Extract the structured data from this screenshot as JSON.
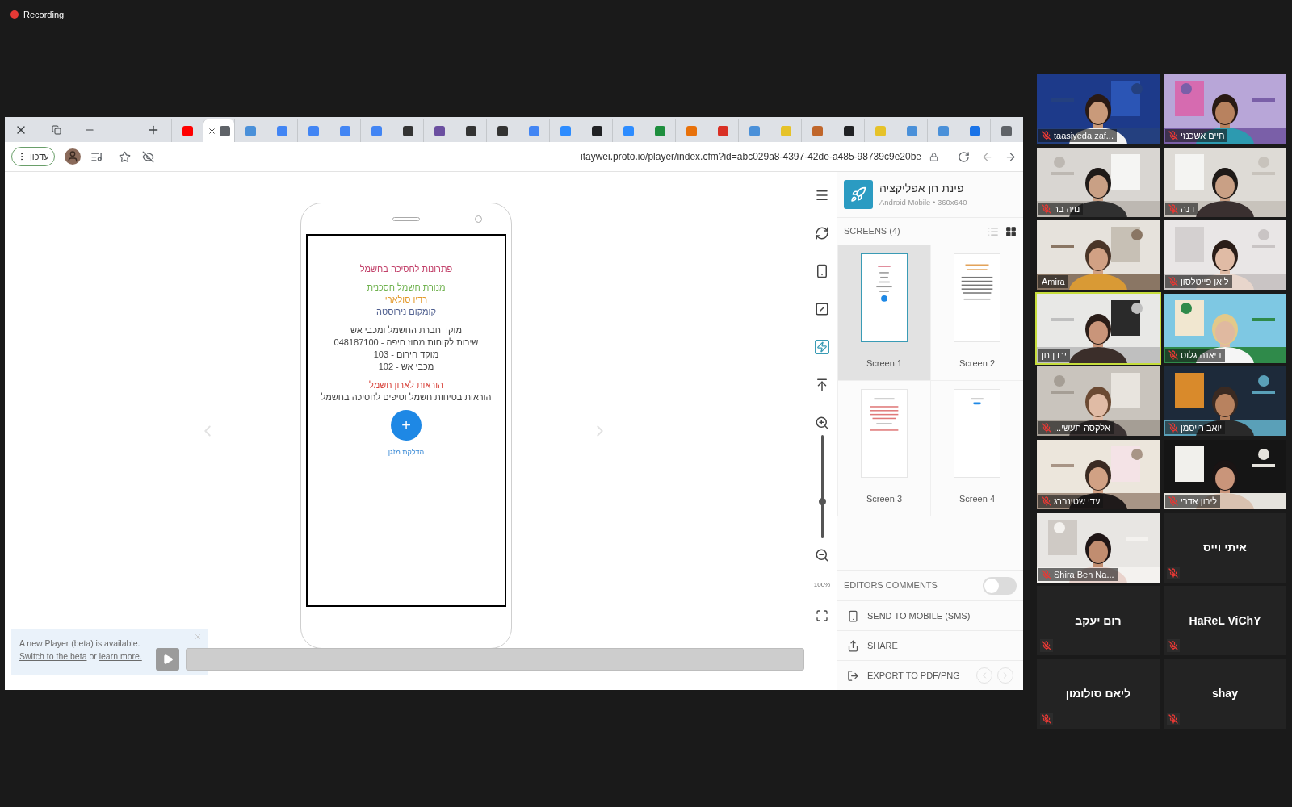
{
  "recording": {
    "label": "Recording"
  },
  "browser": {
    "tabs": [
      {
        "color": "#ff0000",
        "selected": false
      },
      {
        "color": "#5f6368",
        "selected": true
      },
      {
        "color": "#4a90d9",
        "selected": false
      },
      {
        "color": "#4285f4",
        "selected": false
      },
      {
        "color": "#4285f4",
        "selected": false
      },
      {
        "color": "#4285f4",
        "selected": false
      },
      {
        "color": "#4285f4",
        "selected": false
      },
      {
        "color": "#333333",
        "selected": false
      },
      {
        "color": "#6b4fa0",
        "selected": false
      },
      {
        "color": "#333333",
        "selected": false
      },
      {
        "color": "#333333",
        "selected": false
      },
      {
        "color": "#4285f4",
        "selected": false
      },
      {
        "color": "#2d8cff",
        "selected": false
      },
      {
        "color": "#202124",
        "selected": false
      },
      {
        "color": "#2d8cff",
        "selected": false
      },
      {
        "color": "#1e8e3e",
        "selected": false
      },
      {
        "color": "#e8710a",
        "selected": false
      },
      {
        "color": "#d93025",
        "selected": false
      },
      {
        "color": "#4a90d9",
        "selected": false
      },
      {
        "color": "#e6c229",
        "selected": false
      },
      {
        "color": "#c0662b",
        "selected": false
      },
      {
        "color": "#202124",
        "selected": false
      },
      {
        "color": "#e6c229",
        "selected": false
      },
      {
        "color": "#4a90d9",
        "selected": false
      },
      {
        "color": "#4a90d9",
        "selected": false
      },
      {
        "color": "#1a73e8",
        "selected": false
      },
      {
        "color": "#5f6368",
        "selected": false
      }
    ],
    "profile_button": "עדכון",
    "url": "itaywei.proto.io/player/index.cfm?id=abc029a8-4397-42de-a485-98739c9e20be"
  },
  "phone_screen": {
    "groups": [
      {
        "lines": [
          {
            "text": "פתרונות לחסיכה בחשמל",
            "color": "#c2416a"
          }
        ]
      },
      {
        "lines": [
          {
            "text": "מנורת חשמל חסכנית",
            "color": "#6fb24e"
          },
          {
            "text": "רדיו סולארי",
            "color": "#e39a2d"
          },
          {
            "text": "קומקום נירוסטה",
            "color": "#4f5f8f"
          }
        ]
      },
      {
        "lines": [
          {
            "text": "מוקד חברת החשמל ומכבי אש",
            "color": "#444444"
          },
          {
            "text": "שירות לקוחות מחוז חיפה - 048187100",
            "color": "#444444"
          },
          {
            "text": "מוקד חירום - 103",
            "color": "#444444"
          },
          {
            "text": "מכבי אש - 102",
            "color": "#444444"
          }
        ]
      },
      {
        "lines": [
          {
            "text": "הוראות לארון חשמל",
            "color": "#d9473f"
          },
          {
            "text": "הוראות בטיחות חשמל וטיפים לחסיכה בחשמל",
            "color": "#444444"
          }
        ]
      }
    ],
    "fab": "+",
    "fab_label": "הדלקת מזגן"
  },
  "zoom": {
    "level": 0.35,
    "reading": "100%"
  },
  "panel": {
    "title": "פינת חן אפליקציה",
    "subtitle": "Android Mobile • 360x640",
    "screens_heading": "SCREENS (4)",
    "views": [
      {
        "kind": "list",
        "selected": false
      },
      {
        "kind": "grid",
        "selected": true
      }
    ],
    "screens": [
      {
        "label": "Screen 2",
        "selected": false
      },
      {
        "label": "Screen 1",
        "selected": true
      },
      {
        "label": "Screen 4",
        "selected": false
      },
      {
        "label": "Screen 3",
        "selected": false
      }
    ],
    "editors_comments": {
      "label": "EDITORS COMMENTS",
      "on": false
    },
    "actions": [
      {
        "kind": "mobile",
        "label": "SEND TO MOBILE (SMS)"
      },
      {
        "kind": "share",
        "label": "SHARE"
      },
      {
        "kind": "export",
        "label": "EXPORT TO PDF/PNG"
      }
    ]
  },
  "beta_notice": {
    "text": "A new Player (beta) is available.",
    "link_beta": "Switch to the beta",
    "joiner": "or",
    "link_more": "learn more."
  },
  "participants": [
    {
      "name": "חיים אשכנזי",
      "video": true,
      "muted": true,
      "highlighted": false
    },
    {
      "name": "taasiyeda zaf...",
      "video": true,
      "muted": true,
      "highlighted": false
    },
    {
      "name": "דנה",
      "video": true,
      "muted": true,
      "highlighted": false
    },
    {
      "name": "נויה בר",
      "video": true,
      "muted": true,
      "highlighted": false
    },
    {
      "name": "ליאן פייטלסון",
      "video": true,
      "muted": true,
      "highlighted": false
    },
    {
      "name": "Amira",
      "video": true,
      "muted": false,
      "highlighted": false
    },
    {
      "name": "דיאנה גלוס",
      "video": true,
      "muted": true,
      "highlighted": false
    },
    {
      "name": "ירדן חן",
      "video": true,
      "muted": false,
      "highlighted": true
    },
    {
      "name": "יואב רייסמן",
      "video": true,
      "muted": true,
      "highlighted": false
    },
    {
      "name": "אלקסה תעשי...",
      "video": true,
      "muted": true,
      "highlighted": false
    },
    {
      "name": "לירון אדרי",
      "video": true,
      "muted": true,
      "highlighted": false
    },
    {
      "name": "עדי שטינברג",
      "video": true,
      "muted": true,
      "highlighted": false
    },
    {
      "name": "איתי וייס",
      "video": false,
      "muted": true,
      "highlighted": false
    },
    {
      "name": "Shira Ben Na...",
      "video": true,
      "muted": true,
      "highlighted": false
    },
    {
      "name": "HaReL ViChY",
      "video": false,
      "muted": true,
      "highlighted": false
    },
    {
      "name": "רום יעקב",
      "video": false,
      "muted": true,
      "highlighted": false
    },
    {
      "name": "shay",
      "video": false,
      "muted": true,
      "highlighted": false
    },
    {
      "name": "ליאם סולומון",
      "video": false,
      "muted": true,
      "highlighted": false
    }
  ]
}
